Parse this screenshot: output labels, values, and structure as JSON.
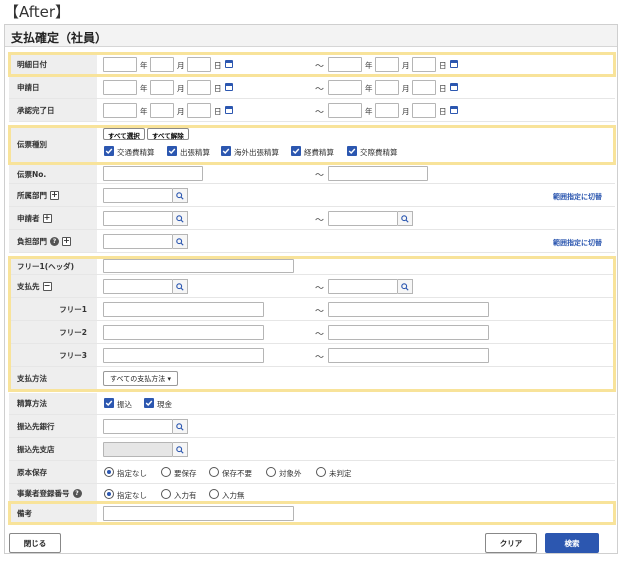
{
  "caption": "【After】",
  "title": "支払確定（社員）",
  "date_units": {
    "year": "年",
    "month": "月",
    "day": "日"
  },
  "tilde": "～",
  "rows": {
    "meisai": "明細日付",
    "shinsei": "申請日",
    "shonin": "承認完了日",
    "denpyo_type": "伝票種別",
    "denpyo_no": "伝票No.",
    "shozoku": "所属部門",
    "shinseisha": "申請者",
    "futan": "負担部門",
    "free_header": "フリー1(ヘッダ)",
    "shiharaisaki": "支払先",
    "free1": "フリー1",
    "free2": "フリー2",
    "free3": "フリー3",
    "shiharai_hoho": "支払方法",
    "seisan_hoho": "精算方法",
    "bank": "振込先銀行",
    "branch": "振込先支店",
    "genpon": "原本保存",
    "jigyosha": "事業者登録番号",
    "biko": "備考"
  },
  "denpyo": {
    "select_all": "すべて選択",
    "clear_all": "すべて解除",
    "types": [
      "交通費精算",
      "出張精算",
      "海外出張精算",
      "経費精算",
      "交際費精算"
    ]
  },
  "range_link": "範囲指定に切替",
  "pay_method_value": "すべての支払方法",
  "seisan_options": [
    "振込",
    "現金"
  ],
  "genpon_options": [
    "指定なし",
    "要保存",
    "保存不要",
    "対象外",
    "未判定"
  ],
  "jigyosha_options": [
    "指定なし",
    "入力有",
    "入力無"
  ],
  "buttons": {
    "close": "閉じる",
    "clear": "クリア",
    "search": "検索"
  }
}
